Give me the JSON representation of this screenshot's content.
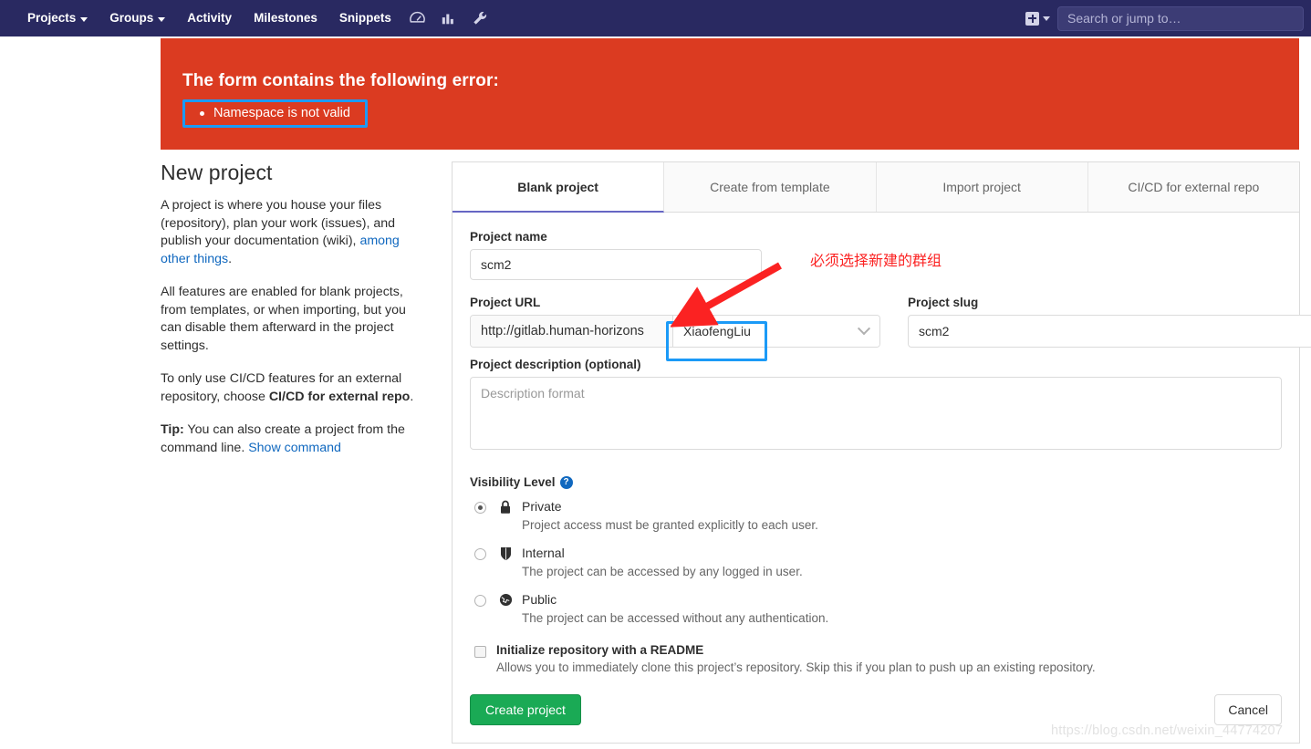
{
  "navbar": {
    "items": [
      {
        "label": "Projects",
        "has_caret": true
      },
      {
        "label": "Groups",
        "has_caret": true
      },
      {
        "label": "Activity",
        "has_caret": false
      },
      {
        "label": "Milestones",
        "has_caret": false
      },
      {
        "label": "Snippets",
        "has_caret": false
      }
    ],
    "icons": [
      "help-icon",
      "analytics-icon",
      "wrench-icon"
    ],
    "plus_label": "+",
    "search_placeholder": "Search or jump to…",
    "search_value": "",
    "background_color": "#292961"
  },
  "error": {
    "title": "The form contains the following error:",
    "items": [
      "Namespace is not valid"
    ],
    "background_color": "#db3b21",
    "highlight_color": "#1b9af7"
  },
  "sidebar": {
    "heading": "New project",
    "paragraph1_pre": "A project is where you house your files (repository), plan your work (issues), and publish your documentation (wiki), ",
    "paragraph1_link": "among other things",
    "paragraph1_post": ".",
    "paragraph2": "All features are enabled for blank projects, from templates, or when importing, but you can disable them afterward in the project settings.",
    "paragraph3_pre": "To only use CI/CD features for an external repository, choose ",
    "paragraph3_bold": "CI/CD for external repo",
    "paragraph3_post": ".",
    "paragraph4_bold": "Tip:",
    "paragraph4_text": " You can also create a project from the command line. ",
    "paragraph4_link": "Show command"
  },
  "tabs": [
    {
      "label": "Blank project",
      "active": true
    },
    {
      "label": "Create from template",
      "active": false
    },
    {
      "label": "Import project",
      "active": false
    },
    {
      "label": "CI/CD for external repo",
      "active": false
    }
  ],
  "form": {
    "project_name_label": "Project name",
    "project_name_value": "scm2",
    "project_name_placeholder": "",
    "project_url_label": "Project URL",
    "project_url_prefix": "http://gitlab.human-horizons",
    "namespace_value": "XiaofengLiu",
    "project_slug_label": "Project slug",
    "project_slug_value": "scm2",
    "description_label": "Project description (optional)",
    "description_value": "",
    "description_placeholder": "Description format",
    "visibility_label": "Visibility Level",
    "visibility_help": "?",
    "visibility_options": [
      {
        "name": "Private",
        "icon": "lock-icon",
        "description": "Project access must be granted explicitly to each user.",
        "selected": true
      },
      {
        "name": "Internal",
        "icon": "shield-icon",
        "description": "The project can be accessed by any logged in user.",
        "selected": false
      },
      {
        "name": "Public",
        "icon": "globe-icon",
        "description": "The project can be accessed without any authentication.",
        "selected": false
      }
    ],
    "readme_label": "Initialize repository with a README",
    "readme_description": "Allows you to immediately clone this project’s repository. Skip this if you plan to push up an existing repository.",
    "readme_checked": false,
    "create_button": "Create project",
    "cancel_button": "Cancel",
    "create_button_color": "#1aaa55"
  },
  "annotation": {
    "text": "必须选择新建的群组",
    "color": "#fb2222"
  },
  "watermark": "https://blog.csdn.net/weixin_44774207"
}
